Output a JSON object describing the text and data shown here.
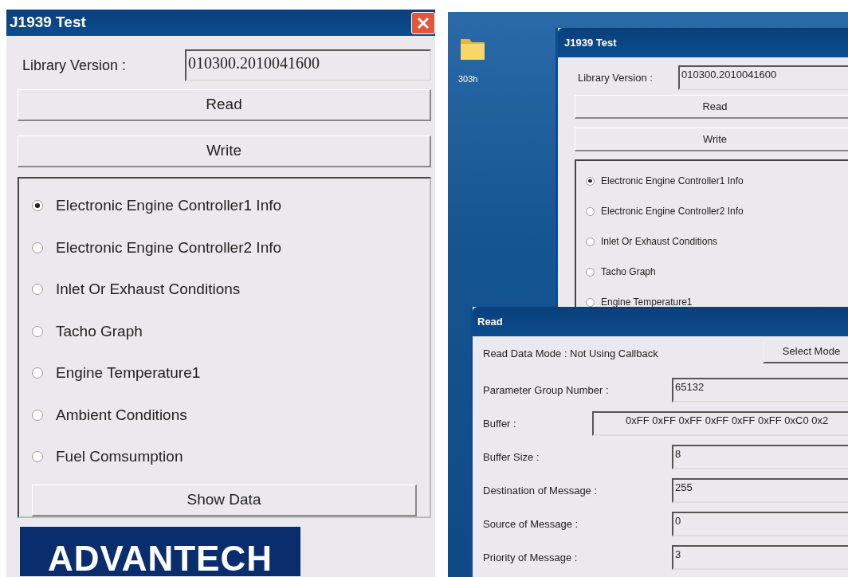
{
  "left_window": {
    "title": "J1939 Test",
    "library_version_label": "Library Version :",
    "library_version": "010300.2010041600",
    "buttons": [
      "Read",
      "Write"
    ],
    "options": [
      {
        "label": "Electronic Engine Controller1 Info",
        "selected": true
      },
      {
        "label": "Electronic Engine Controller2 Info",
        "selected": false
      },
      {
        "label": "Inlet Or Exhaust Conditions",
        "selected": false
      },
      {
        "label": "Tacho Graph",
        "selected": false
      },
      {
        "label": "Engine Temperature1",
        "selected": false
      },
      {
        "label": "Ambient Conditions",
        "selected": false
      },
      {
        "label": "Fuel Comsumption",
        "selected": false
      }
    ],
    "show_data_button": "Show Data",
    "logo": "ADVANTECH"
  },
  "desktop": {
    "folder_label": "303h",
    "main_window": {
      "title": "J1939 Test",
      "library_version_label": "Library Version :",
      "library_version": "010300.2010041600",
      "buttons": [
        "Read",
        "Write"
      ],
      "options": [
        {
          "label": "Electronic Engine Controller1 Info",
          "selected": true
        },
        {
          "label": "Electronic Engine Controller2 Info",
          "selected": false
        },
        {
          "label": "Inlet Or Exhaust Conditions",
          "selected": false
        },
        {
          "label": "Tacho Graph",
          "selected": false
        },
        {
          "label": "Engine Temperature1",
          "selected": false
        }
      ]
    },
    "read_dialog": {
      "title": "Read",
      "mode_text": "Read Data Mode : Not Using Callback",
      "select_mode_button": "Select Mode",
      "fields": [
        {
          "label": "Parameter Group Number :",
          "value": "65132",
          "wide": false
        },
        {
          "label": "Buffer :",
          "value": "0xFF 0xFF 0xFF 0xFF 0xFF 0xFF 0xC0 0x2",
          "wide": true
        },
        {
          "label": "Buffer Size :",
          "value": "8",
          "wide": false
        },
        {
          "label": "Destination of Message :",
          "value": "255",
          "wide": false
        },
        {
          "label": "Source of Message :",
          "value": "0",
          "wide": false
        },
        {
          "label": "Priority of Message :",
          "value": "3",
          "wide": false
        }
      ]
    }
  }
}
